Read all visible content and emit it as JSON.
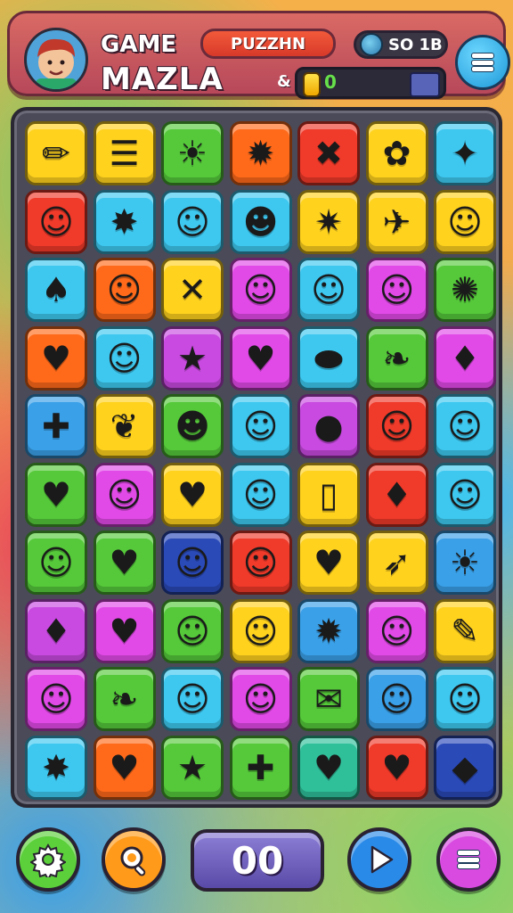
{
  "header": {
    "title_line1": "GAME",
    "title_line2": "MAZLA",
    "mode_label": "PUZZHN",
    "score_label": "SO 1B",
    "progress_prefix": "&",
    "progress_value": "0",
    "avatar_icon": "player-avatar",
    "menu_icon": "hamburger-menu-icon"
  },
  "board": {
    "rows": 10,
    "cols": 7,
    "tiles": [
      [
        {
          "color": "#ffd21e",
          "icon": "✏"
        },
        {
          "color": "#ffd21e",
          "icon": "☰"
        },
        {
          "color": "#55c93a",
          "icon": "☀"
        },
        {
          "color": "#ff6a1a",
          "icon": "✹"
        },
        {
          "color": "#f03a2a",
          "icon": "✖"
        },
        {
          "color": "#ffd21e",
          "icon": "✿"
        },
        {
          "color": "#3ec8f0",
          "icon": "✦"
        }
      ],
      [
        {
          "color": "#f03a2a",
          "icon": "☺"
        },
        {
          "color": "#3ec8f0",
          "icon": "✸"
        },
        {
          "color": "#3ec8f0",
          "icon": "☺"
        },
        {
          "color": "#3ec8f0",
          "icon": "☻"
        },
        {
          "color": "#ffd21e",
          "icon": "✷"
        },
        {
          "color": "#ffd21e",
          "icon": "✈"
        },
        {
          "color": "#ffd21e",
          "icon": "☺"
        }
      ],
      [
        {
          "color": "#3ec8f0",
          "icon": "♠"
        },
        {
          "color": "#ff6a1a",
          "icon": "☺"
        },
        {
          "color": "#ffd21e",
          "icon": "✕"
        },
        {
          "color": "#e24ae8",
          "icon": "☺"
        },
        {
          "color": "#3ec8f0",
          "icon": "☺"
        },
        {
          "color": "#e24ae8",
          "icon": "☺"
        },
        {
          "color": "#55c93a",
          "icon": "✺"
        }
      ],
      [
        {
          "color": "#ff6a1a",
          "icon": "♥"
        },
        {
          "color": "#3ec8f0",
          "icon": "☺"
        },
        {
          "color": "#c84ae0",
          "icon": "★"
        },
        {
          "color": "#e24ae8",
          "icon": "♥"
        },
        {
          "color": "#3ec8f0",
          "icon": "⬬"
        },
        {
          "color": "#55c93a",
          "icon": "❧"
        },
        {
          "color": "#e24ae8",
          "icon": "♦"
        }
      ],
      [
        {
          "color": "#3aa0e8",
          "icon": "✚"
        },
        {
          "color": "#ffd21e",
          "icon": "❦"
        },
        {
          "color": "#55c93a",
          "icon": "☻"
        },
        {
          "color": "#3ec8f0",
          "icon": "☺"
        },
        {
          "color": "#c84ae0",
          "icon": "●"
        },
        {
          "color": "#f03a2a",
          "icon": "☺"
        },
        {
          "color": "#3ec8f0",
          "icon": "☺"
        }
      ],
      [
        {
          "color": "#55c93a",
          "icon": "♥"
        },
        {
          "color": "#e24ae8",
          "icon": "☺"
        },
        {
          "color": "#ffd21e",
          "icon": "♥"
        },
        {
          "color": "#3ec8f0",
          "icon": "☺"
        },
        {
          "color": "#ffd21e",
          "icon": "▯"
        },
        {
          "color": "#f03a2a",
          "icon": "♦"
        },
        {
          "color": "#3ec8f0",
          "icon": "☺"
        }
      ],
      [
        {
          "color": "#55c93a",
          "icon": "☺"
        },
        {
          "color": "#55c93a",
          "icon": "♥"
        },
        {
          "color": "#2a4ab8",
          "icon": "☺"
        },
        {
          "color": "#f03a2a",
          "icon": "☺"
        },
        {
          "color": "#ffd21e",
          "icon": "♥"
        },
        {
          "color": "#ffd21e",
          "icon": "➶"
        },
        {
          "color": "#3aa0e8",
          "icon": "☀"
        }
      ],
      [
        {
          "color": "#c84ae0",
          "icon": "♦"
        },
        {
          "color": "#e24ae8",
          "icon": "♥"
        },
        {
          "color": "#55c93a",
          "icon": "☺"
        },
        {
          "color": "#ffd21e",
          "icon": "☺"
        },
        {
          "color": "#3aa0e8",
          "icon": "✹"
        },
        {
          "color": "#e24ae8",
          "icon": "☺"
        },
        {
          "color": "#ffd21e",
          "icon": "✎"
        }
      ],
      [
        {
          "color": "#e24ae8",
          "icon": "☺"
        },
        {
          "color": "#55c93a",
          "icon": "❧"
        },
        {
          "color": "#3ec8f0",
          "icon": "☺"
        },
        {
          "color": "#e24ae8",
          "icon": "☺"
        },
        {
          "color": "#55c93a",
          "icon": "✉"
        },
        {
          "color": "#3aa0e8",
          "icon": "☺"
        },
        {
          "color": "#3ec8f0",
          "icon": "☺"
        }
      ],
      [
        {
          "color": "#3ec8f0",
          "icon": "✸"
        },
        {
          "color": "#ff6a1a",
          "icon": "♥"
        },
        {
          "color": "#55c93a",
          "icon": "★"
        },
        {
          "color": "#55c93a",
          "icon": "✚"
        },
        {
          "color": "#2fc09a",
          "icon": "♥"
        },
        {
          "color": "#f03a2a",
          "icon": "♥"
        },
        {
          "color": "#2a4ab8",
          "icon": "◆"
        }
      ]
    ]
  },
  "footer": {
    "settings_icon": "gear-icon",
    "search_icon": "magnifier-icon",
    "counter_value": "00",
    "play_icon": "play-icon",
    "menu_icon": "hamburger-menu-icon"
  },
  "colors": {
    "settings_button": "#5bd03a",
    "search_button": "#ff9a1a",
    "play_button": "#2a8ae8",
    "menu_button": "#d84ae0"
  }
}
